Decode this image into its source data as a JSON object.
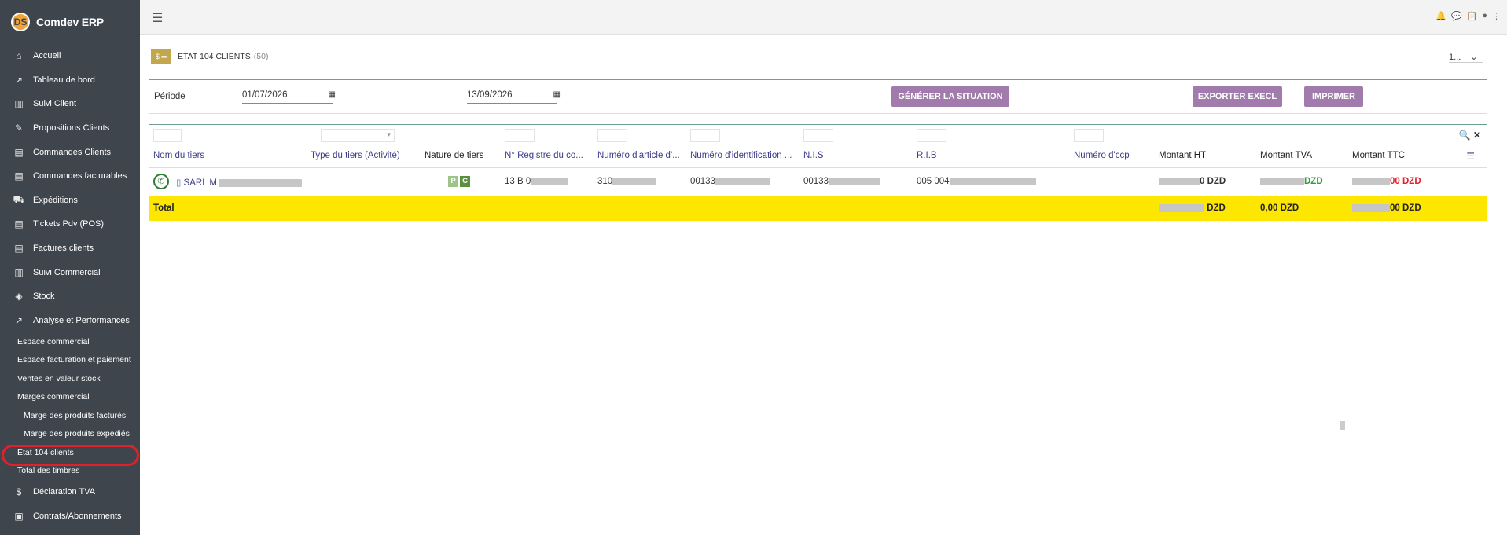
{
  "brand": {
    "name": "Comdev ERP",
    "logo_text": "DS"
  },
  "sidebar": {
    "items": [
      {
        "label": "Accueil",
        "icon": "home-icon",
        "glyph": "⌂"
      },
      {
        "label": "Tableau de bord",
        "icon": "chart-icon",
        "glyph": "↗"
      },
      {
        "label": "Suivi Client",
        "icon": "building-icon",
        "glyph": "▥"
      },
      {
        "label": "Propositions Clients",
        "icon": "edit-icon",
        "glyph": "✎"
      },
      {
        "label": "Commandes Clients",
        "icon": "document-icon",
        "glyph": "▤"
      },
      {
        "label": "Commandes facturables",
        "icon": "document-icon",
        "glyph": "▤"
      },
      {
        "label": "Expéditions",
        "icon": "dolly-icon",
        "glyph": "⛟"
      },
      {
        "label": "Tickets Pdv (POS)",
        "icon": "document-icon",
        "glyph": "▤"
      },
      {
        "label": "Factures clients",
        "icon": "invoice-icon",
        "glyph": "▤"
      },
      {
        "label": "Suivi Commercial",
        "icon": "building-icon",
        "glyph": "▥"
      },
      {
        "label": "Stock",
        "icon": "box-icon",
        "glyph": "◈"
      },
      {
        "label": "Analyse et Performances",
        "icon": "chart-icon",
        "glyph": "↗"
      }
    ],
    "subitems": [
      {
        "label": "Espace commercial",
        "level": 1
      },
      {
        "label": "Espace facturation et paiement",
        "level": 1
      },
      {
        "label": "Ventes en valeur stock",
        "level": 1
      },
      {
        "label": "Marges commercial",
        "level": 1
      },
      {
        "label": "Marge des produits facturés",
        "level": 2
      },
      {
        "label": "Marge des produits expediés",
        "level": 2
      },
      {
        "label": "Etat 104 clients",
        "level": 1
      },
      {
        "label": "Total des timbres",
        "level": 1
      }
    ],
    "bottom_items": [
      {
        "label": "Déclaration TVA",
        "icon": "dollar-icon",
        "glyph": "$"
      },
      {
        "label": "Contrats/Abonnements",
        "icon": "briefcase-icon",
        "glyph": "▣"
      }
    ]
  },
  "header": {
    "badge": "$ ═",
    "title": "ETAT 104 CLIENTS",
    "count": "(50)",
    "page_size": "1..."
  },
  "filters": {
    "periode_label": "Période",
    "date_from": "01/07/2026",
    "date_to": "13/09/2026",
    "btn_generate": "GÉNÉRER LA SITUATION",
    "btn_export": "EXPORTER EXECL",
    "btn_print": "IMPRIMER"
  },
  "table": {
    "columns": [
      "Nom du tiers",
      "Type du tiers (Activité)",
      "Nature de tiers",
      "N° Registre du co...",
      "Numéro d'article d'...",
      "Numéro d'identification ...",
      "N.I.S",
      "R.I.B",
      "Numéro d'ccp",
      "Montant HT",
      "Montant TVA",
      "Montant TTC"
    ],
    "row": {
      "name": "SARL M",
      "nature_p": "P",
      "nature_c": "C",
      "registre": "13 B 0",
      "article": "310",
      "identification": "00133",
      "nis": "00133",
      "rib": "005 004",
      "montant_ht": "0 DZD",
      "montant_tva": "DZD",
      "montant_ttc": "00 DZD"
    },
    "total": {
      "label": "Total",
      "montant_ht": " DZD",
      "montant_tva": "0,00 DZD",
      "montant_ttc": "00 DZD"
    }
  },
  "colors": {
    "sidebar": "#3e454d",
    "button": "#a07bac",
    "total_row": "#fde600",
    "accent_line": "#6d9f95"
  }
}
